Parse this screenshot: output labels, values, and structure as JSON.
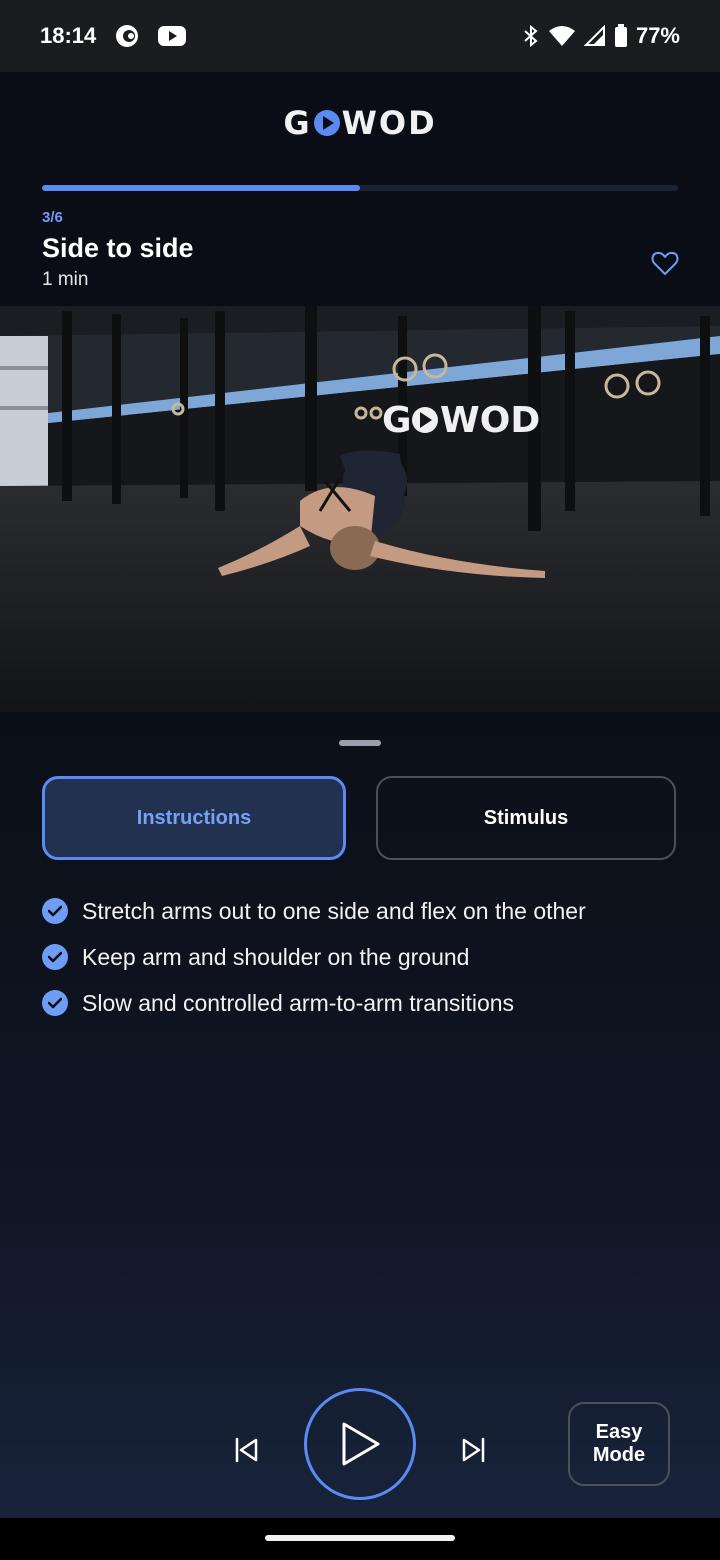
{
  "status_bar": {
    "time": "18:14",
    "battery": "77%",
    "icons": [
      "vpn-icon",
      "youtube-icon",
      "bluetooth-icon",
      "wifi-icon",
      "signal-icon",
      "battery-icon"
    ]
  },
  "header": {
    "logo_left": "G",
    "logo_right": "WOD",
    "progress": {
      "current": 3,
      "total": 6,
      "fraction": 0.5
    },
    "step_label": "3/6",
    "title": "Side to side",
    "duration": "1 min"
  },
  "video": {
    "wall_logo_left": "G",
    "wall_logo_right": "WOD"
  },
  "tabs": [
    {
      "label": "Instructions",
      "active": true
    },
    {
      "label": "Stimulus",
      "active": false
    }
  ],
  "instructions": [
    "Stretch arms out to one side and flex on the other",
    "Keep arm and shoulder on the ground",
    "Slow and controlled arm-to-arm transitions"
  ],
  "controls": {
    "easy_mode_label": "Easy Mode"
  },
  "colors": {
    "accent": "#5b8bf2",
    "accent_text": "#75a2f5",
    "background": "#0b0f18"
  }
}
